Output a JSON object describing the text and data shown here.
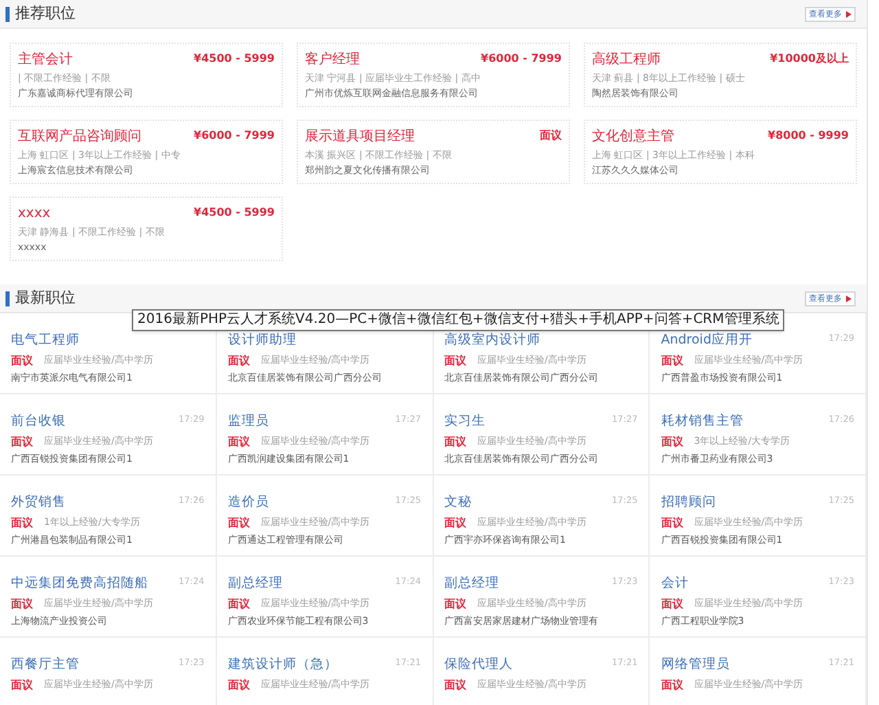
{
  "recommended": {
    "title": "推荐职位",
    "more": "查看更多",
    "jobs": [
      {
        "title": "主管会计",
        "salary": "¥4500 - 5999",
        "meta": "| 不限工作经验 | 不限",
        "company": "广东嘉诚商标代理有限公司"
      },
      {
        "title": "客户经理",
        "salary": "¥6000 - 7999",
        "meta": "天津 宁河县 | 应届毕业生工作经验 | 高中",
        "company": "广州市优炼互联网金融信息服务有限公司"
      },
      {
        "title": "高级工程师",
        "salary": "¥10000及以上",
        "meta": "天津 蓟县 | 8年以上工作经验 | 硕士",
        "company": "陶然居装饰有限公司"
      },
      {
        "title": "互联网产品咨询顾问",
        "salary": "¥6000 - 7999",
        "meta": "上海 虹口区 | 3年以上工作经验 | 中专",
        "company": "上海宸玄信息技术有限公司"
      },
      {
        "title": "展示道具项目经理",
        "salary": "面议",
        "meta": "本溪 振兴区 | 不限工作经验 | 不限",
        "company": "郑州韵之夏文化传播有限公司"
      },
      {
        "title": "文化创意主管",
        "salary": "¥8000 - 9999",
        "meta": "上海 虹口区 | 3年以上工作经验 | 本科",
        "company": "江苏久久久媒体公司"
      },
      {
        "title": "xxxx",
        "salary": "¥4500 - 5999",
        "meta": "天津 静海县 | 不限工作经验 | 不限",
        "company": "xxxxx"
      }
    ]
  },
  "latest": {
    "title": "最新职位",
    "more": "查看更多",
    "jobs": [
      {
        "title": "电气工程师",
        "pay": "面议",
        "req": "应届毕业生经验/高中学历",
        "company": "南宁市英派尔电气有限公司1"
      },
      {
        "title": "设计师助理",
        "pay": "面议",
        "req": "应届毕业生经验/高中学历",
        "company": "北京百佳居装饰有限公司广西分公司"
      },
      {
        "title": "高级室内设计师",
        "pay": "面议",
        "req": "应届毕业生经验/高中学历",
        "company": "北京百佳居装饰有限公司广西分公司"
      },
      {
        "title": "Android应用开",
        "time": "17:29",
        "pay": "面议",
        "req": "应届毕业生经验/高中学历",
        "company": "广西普盈市场投资有限公司1"
      },
      {
        "title": "前台收银",
        "time": "17:29",
        "pay": "面议",
        "req": "应届毕业生经验/高中学历",
        "company": "广西百锐投资集团有限公司1"
      },
      {
        "title": "监理员",
        "time": "17:27",
        "pay": "面议",
        "req": "应届毕业生经验/高中学历",
        "company": "广西凯润建设集团有限公司1"
      },
      {
        "title": "实习生",
        "time": "17:27",
        "pay": "面议",
        "req": "应届毕业生经验/高中学历",
        "company": "北京百佳居装饰有限公司广西分公司"
      },
      {
        "title": "耗材销售主管",
        "time": "17:26",
        "pay": "面议",
        "req": "3年以上经验/大专学历",
        "company": "广州市番卫药业有限公司3"
      },
      {
        "title": "外贸销售",
        "time": "17:26",
        "pay": "面议",
        "req": "1年以上经验/大专学历",
        "company": "广州港昌包装制品有限公司1"
      },
      {
        "title": "造价员",
        "time": "17:25",
        "pay": "面议",
        "req": "应届毕业生经验/高中学历",
        "company": "广西通达工程管理有限公司"
      },
      {
        "title": "文秘",
        "time": "17:25",
        "pay": "面议",
        "req": "应届毕业生经验/高中学历",
        "company": "广西宇亦环保咨询有限公司1"
      },
      {
        "title": "招聘顾问",
        "time": "17:25",
        "pay": "面议",
        "req": "应届毕业生经验/高中学历",
        "company": "广西百锐投资集团有限公司1"
      },
      {
        "title": "中远集团免费高招随船",
        "time": "17:24",
        "pay": "面议",
        "req": "应届毕业生经验/高中学历",
        "company": "上海物流产业投资公司"
      },
      {
        "title": "副总经理",
        "time": "17:24",
        "pay": "面议",
        "req": "应届毕业生经验/高中学历",
        "company": "广西农业环保节能工程有限公司3"
      },
      {
        "title": "副总经理",
        "time": "17:23",
        "pay": "面议",
        "req": "应届毕业生经验/高中学历",
        "company": "广西富安居家居建材广场物业管理有"
      },
      {
        "title": "会计",
        "time": "17:23",
        "pay": "面议",
        "req": "应届毕业生经验/高中学历",
        "company": "广西工程职业学院3"
      },
      {
        "title": "西餐厅主管",
        "time": "17:23",
        "pay": "面议",
        "req": "应届毕业生经验/高中学历"
      },
      {
        "title": "建筑设计师（急）",
        "time": "17:21",
        "pay": "面议",
        "req": "应届毕业生经验/高中学历"
      },
      {
        "title": "保险代理人",
        "time": "17:21",
        "pay": "面议",
        "req": "应届毕业生经验/高中学历"
      },
      {
        "title": "网络管理员",
        "time": "17:21",
        "pay": "面议",
        "req": "应届毕业生经验/高中学历"
      }
    ]
  },
  "tooltip": "2016最新PHP云人才系统V4.20—PC+微信+微信红包+微信支付+猎头+手机APP+问答+CRM管理系统"
}
